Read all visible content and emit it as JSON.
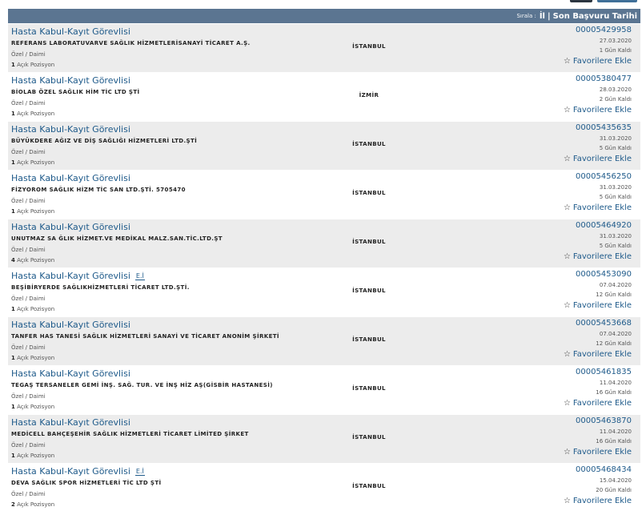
{
  "sort": {
    "label": "Sırala :",
    "option_city": "İl",
    "separator": "|",
    "option_date": "Son Başvuru Tarihi"
  },
  "colors": {
    "header_bg": "#5b7591",
    "link": "#1e5a8a",
    "row_shade": "#ececec"
  },
  "listings": [
    {
      "title": "Hasta Kabul-Kayıt Görevlisi",
      "badge": "",
      "company": "REFERANS LABORATUVARVE SAĞLIK HİZMETLERİSANAYİ TİCARET A.Ş.",
      "type": "Özel / Daimi",
      "positions": "1",
      "positions_label": "Açık Pozisyon",
      "city": "İSTANBUL",
      "ad_no": "00005429958",
      "date": "27.03.2020",
      "remaining": "1 Gün Kaldı",
      "fav": "Favorilere Ekle"
    },
    {
      "title": "Hasta Kabul-Kayıt Görevlisi",
      "badge": "",
      "company": "BİOLAB ÖZEL SAĞLIK HİM TİC LTD ŞTİ",
      "type": "Özel / Daimi",
      "positions": "1",
      "positions_label": "Açık Pozisyon",
      "city": "İZMİR",
      "ad_no": "00005380477",
      "date": "28.03.2020",
      "remaining": "2 Gün Kaldı",
      "fav": "Favorilere Ekle"
    },
    {
      "title": "Hasta Kabul-Kayıt Görevlisi",
      "badge": "",
      "company": "BÜYÜKDERE AĞIZ VE DİŞ SAĞLIĞI HİZMETLERİ LTD.ŞTİ",
      "type": "Özel / Daimi",
      "positions": "1",
      "positions_label": "Açık Pozisyon",
      "city": "İSTANBUL",
      "ad_no": "00005435635",
      "date": "31.03.2020",
      "remaining": "5 Gün Kaldı",
      "fav": "Favorilere Ekle"
    },
    {
      "title": "Hasta Kabul-Kayıt Görevlisi",
      "badge": "",
      "company": "FİZYOROM SAĞLIK HİZM TİC SAN LTD.ŞTİ. 5705470",
      "type": "Özel / Daimi",
      "positions": "1",
      "positions_label": "Açık Pozisyon",
      "city": "İSTANBUL",
      "ad_no": "00005456250",
      "date": "31.03.2020",
      "remaining": "5 Gün Kaldı",
      "fav": "Favorilere Ekle"
    },
    {
      "title": "Hasta Kabul-Kayıt Görevlisi",
      "badge": "",
      "company": "UNUTMAZ SA ĞLIK HİZMET.VE MEDİKAL MALZ.SAN.TİC.LTD.ŞT",
      "type": "Özel / Daimi",
      "positions": "4",
      "positions_label": "Açık Pozisyon",
      "city": "İSTANBUL",
      "ad_no": "00005464920",
      "date": "31.03.2020",
      "remaining": "5 Gün Kaldı",
      "fav": "Favorilere Ekle"
    },
    {
      "title": "Hasta Kabul-Kayıt Görevlisi",
      "badge": "E.İ",
      "company": "BEŞİBİRYERDE SAĞLIKHİZMETLERİ TİCARET LTD.ŞTİ.",
      "type": "Özel / Daimi",
      "positions": "1",
      "positions_label": "Açık Pozisyon",
      "city": "İSTANBUL",
      "ad_no": "00005453090",
      "date": "07.04.2020",
      "remaining": "12 Gün Kaldı",
      "fav": "Favorilere Ekle"
    },
    {
      "title": "Hasta Kabul-Kayıt Görevlisi",
      "badge": "",
      "company": "TANFER HAS TANESİ SAĞLIK HİZMETLERİ SANAYİ VE TİCARET ANONİM ŞİRKETİ",
      "type": "Özel / Daimi",
      "positions": "1",
      "positions_label": "Açık Pozisyon",
      "city": "İSTANBUL",
      "ad_no": "00005453668",
      "date": "07.04.2020",
      "remaining": "12 Gün Kaldı",
      "fav": "Favorilere Ekle"
    },
    {
      "title": "Hasta Kabul-Kayıt Görevlisi",
      "badge": "",
      "company": "TEGAŞ TERSANELER GEMİ İNŞ. SAĞ. TUR. VE İNŞ HİZ AŞ(GİSBİR HASTANESİ)",
      "type": "Özel / Daimi",
      "positions": "1",
      "positions_label": "Açık Pozisyon",
      "city": "İSTANBUL",
      "ad_no": "00005461835",
      "date": "11.04.2020",
      "remaining": "16 Gün Kaldı",
      "fav": "Favorilere Ekle"
    },
    {
      "title": "Hasta Kabul-Kayıt Görevlisi",
      "badge": "",
      "company": "MEDİCELL BAHÇEŞEHİR SAĞLIK HİZMETLERİ TİCARET LİMİTED ŞİRKET",
      "type": "Özel / Daimi",
      "positions": "1",
      "positions_label": "Açık Pozisyon",
      "city": "İSTANBUL",
      "ad_no": "00005463870",
      "date": "11.04.2020",
      "remaining": "16 Gün Kaldı",
      "fav": "Favorilere Ekle"
    },
    {
      "title": "Hasta Kabul-Kayıt Görevlisi",
      "badge": "E.İ",
      "company": "DEVA SAĞLIK SPOR HİZMETLERİ TİC LTD ŞTİ",
      "type": "Özel / Daimi",
      "positions": "2",
      "positions_label": "Açık Pozisyon",
      "city": "İSTANBUL",
      "ad_no": "00005468434",
      "date": "15.04.2020",
      "remaining": "20 Gün Kaldı",
      "fav": "Favorilere Ekle"
    }
  ]
}
